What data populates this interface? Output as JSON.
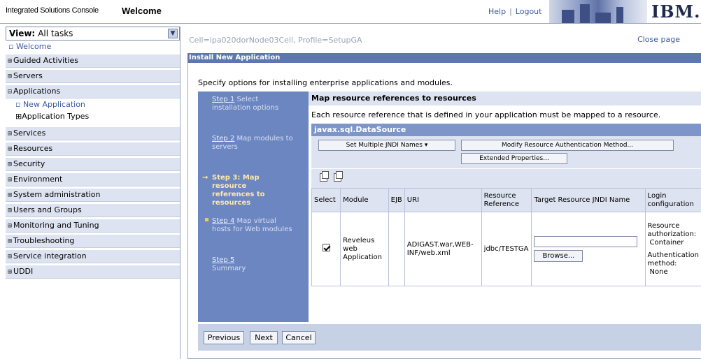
{
  "header": {
    "app_title": "Integrated Solutions Console",
    "page_title": "Welcome",
    "help": "Help",
    "separator": "|",
    "logout": "Logout",
    "logo": "IBM."
  },
  "nav": {
    "view_label": "View:",
    "view_value": "All tasks",
    "welcome": "Welcome",
    "items": [
      "Guided Activities",
      "Servers",
      "Applications",
      "Services",
      "Resources",
      "Security",
      "Environment",
      "System administration",
      "Users and Groups",
      "Monitoring and Tuning",
      "Troubleshooting",
      "Service integration",
      "UDDI"
    ],
    "expand_symbol": "⊞",
    "collapse_symbol": "⊟",
    "sub_new_application": "New Application",
    "sub_application_types": "Application Types"
  },
  "main": {
    "breadcrumb": "Cell=ipa020dorNode03Cell, Profile=SetupGA",
    "close_page": "Close page",
    "panel_title": "Install New Application",
    "intro": "Specify options for installing enterprise applications and modules."
  },
  "steps": [
    {
      "link": "Step 1",
      "rest": "Select installation options"
    },
    {
      "link": "Step 2",
      "rest": "Map modules to servers"
    },
    {
      "current": "Step 3: Map resource references to resources"
    },
    {
      "link": "Step 4",
      "rest": "Map virtual hosts for Web modules"
    },
    {
      "link": "Step 5",
      "rest": "Summary"
    }
  ],
  "content": {
    "heading": "Map resource references to resources",
    "description": "Each resource reference that is defined in your application must be mapped to a resource.",
    "datasource": "javax.sql.DataSource",
    "btn_set_jndi": "Set Multiple JNDI Names ▾",
    "btn_modify_auth": "Modify Resource Authentication Method...",
    "btn_extended": "Extended Properties..."
  },
  "table": {
    "headers": [
      "Select",
      "Module",
      "EJB",
      "URI",
      "Resource Reference",
      "Target Resource JNDI Name",
      "Login configuration"
    ],
    "row": {
      "module": "Reveleus web Application",
      "ejb": "",
      "uri": "ADIGAST.war,WEB-INF/web.xml",
      "resource_ref": "jdbc/TESTGA",
      "jndi_value": "",
      "browse": "Browse...",
      "login_1": "Resource authorization:",
      "login_2": "Container",
      "login_3": "Authentication method:",
      "login_4": "None"
    }
  },
  "buttons": {
    "previous": "Previous",
    "next": "Next",
    "cancel": "Cancel"
  }
}
